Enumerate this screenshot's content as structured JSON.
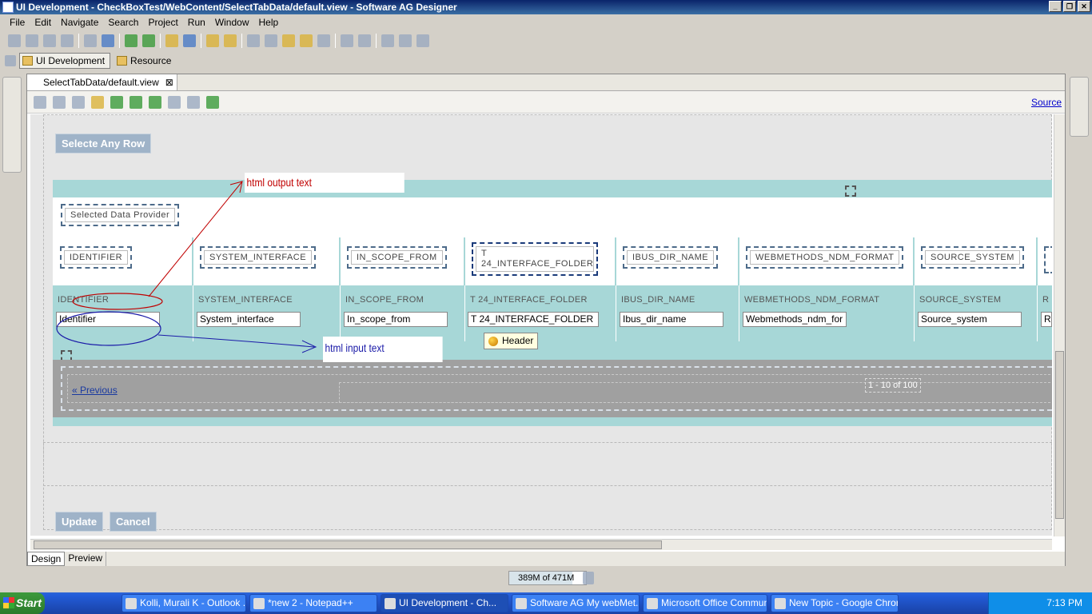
{
  "window": {
    "title": "UI Development - CheckBoxTest/WebContent/SelectTabData/default.view - Software AG Designer"
  },
  "menu": [
    "File",
    "Edit",
    "Navigate",
    "Search",
    "Project",
    "Run",
    "Window",
    "Help"
  ],
  "perspectives": [
    {
      "label": "UI Development",
      "active": true
    },
    {
      "label": "Resource",
      "active": false
    }
  ],
  "editor": {
    "tab": "SelectTabData/default.view",
    "source_link": "Source",
    "bottom_tabs": [
      "Design",
      "Preview"
    ]
  },
  "page": {
    "select_button": "Selecte Any Row",
    "provider_label": "Selected Data Provider",
    "columns": [
      {
        "header": "IDENTIFIER",
        "label": "IDENTIFIER",
        "value": "Identifier"
      },
      {
        "header": "SYSTEM_INTERFACE",
        "label": "SYSTEM_INTERFACE",
        "value": "System_interface"
      },
      {
        "header": "IN_SCOPE_FROM",
        "label": "IN_SCOPE_FROM",
        "value": "In_scope_from"
      },
      {
        "header": "T 24_INTERFACE_FOLDER",
        "label": "T 24_INTERFACE_FOLDER",
        "value": "T 24_INTERFACE_FOLDER"
      },
      {
        "header": "IBUS_DIR_NAME",
        "label": "IBUS_DIR_NAME",
        "value": "Ibus_dir_name"
      },
      {
        "header": "WEBMETHODS_NDM_FORMAT",
        "label": "WEBMETHODS_NDM_FORMAT",
        "value": "Webmethods_ndm_for"
      },
      {
        "header": "SOURCE_SYSTEM",
        "label": "SOURCE_SYSTEM",
        "value": "Source_system"
      },
      {
        "header": "",
        "label": "R",
        "value": "R"
      }
    ],
    "header_tooltip": "Header",
    "previous_link": "« Previous",
    "page_count": "1 - 10 of 100",
    "update_button": "Update",
    "cancel_button": "Cancel"
  },
  "annotations": {
    "output_text": "html output text",
    "input_text": "html input text"
  },
  "status": {
    "memory": "389M of 471M",
    "memory_fraction": 0.826
  },
  "taskbar": {
    "start": "Start",
    "tasks": [
      {
        "label": "Kolli, Murali K - Outlook ...",
        "active": false
      },
      {
        "label": "*new  2 - Notepad++",
        "active": false
      },
      {
        "label": "UI Development - Ch...",
        "active": true
      },
      {
        "label": "Software AG My webMet...",
        "active": false
      },
      {
        "label": "Microsoft Office Commun...",
        "active": false
      },
      {
        "label": "New Topic - Google Chrome",
        "active": false
      }
    ],
    "clock": "7:13 PM"
  },
  "colors": {
    "table_bg": "#a7d7d7",
    "pager_bg": "#a0a0a0",
    "annotation_red": "#c00000",
    "annotation_blue": "#1a1aa8"
  }
}
